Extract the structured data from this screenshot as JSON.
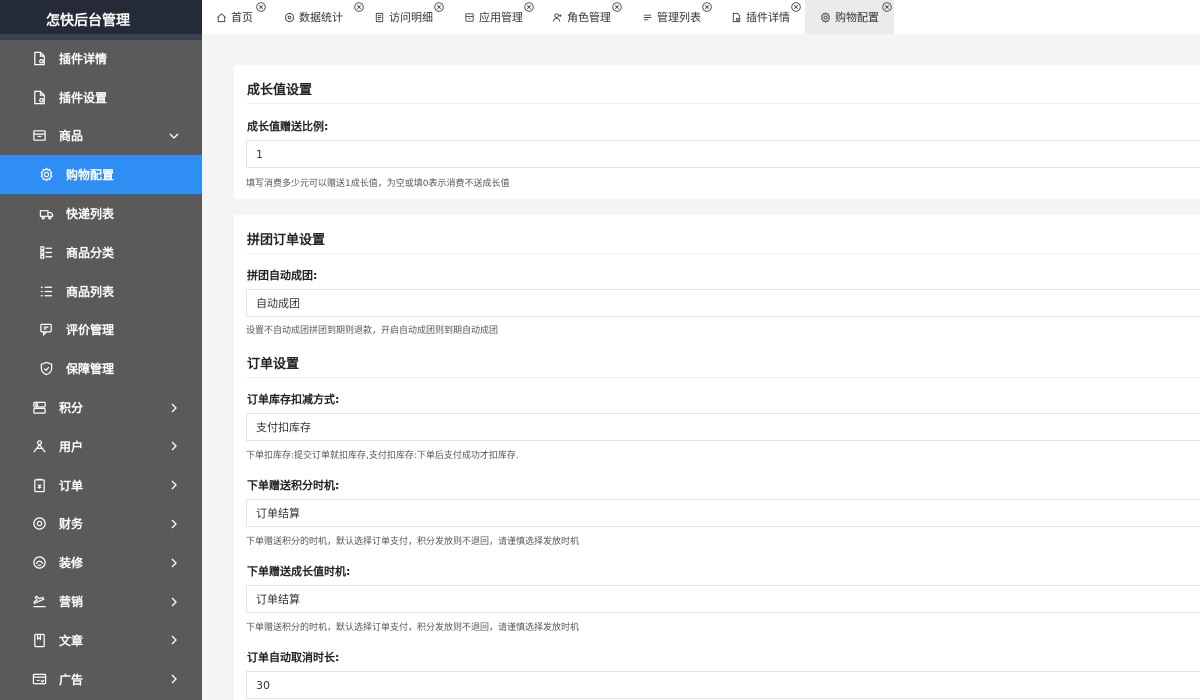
{
  "app": {
    "title": "怎快后台管理"
  },
  "tabs": [
    {
      "label": "首页",
      "icon": "home-icon"
    },
    {
      "label": "数据统计",
      "icon": "chart-icon"
    },
    {
      "label": "访问明细",
      "icon": "document-icon"
    },
    {
      "label": "应用管理",
      "icon": "app-icon"
    },
    {
      "label": "角色管理",
      "icon": "user-role-icon"
    },
    {
      "label": "管理列表",
      "icon": "list-icon"
    },
    {
      "label": "插件详情",
      "icon": "file-icon"
    },
    {
      "label": "购物配置",
      "icon": "gear-icon"
    }
  ],
  "sidebar": {
    "items": [
      {
        "label": "插件详情",
        "icon": "file-icon"
      },
      {
        "label": "插件设置",
        "icon": "file-settings-icon"
      },
      {
        "label": "商品",
        "icon": "box-icon"
      },
      {
        "label": "购物配置",
        "icon": "gear-icon"
      },
      {
        "label": "快递列表",
        "icon": "truck-icon"
      },
      {
        "label": "商品分类",
        "icon": "category-icon"
      },
      {
        "label": "商品列表",
        "icon": "list-icon"
      },
      {
        "label": "评价管理",
        "icon": "comment-icon"
      },
      {
        "label": "保障管理",
        "icon": "shield-icon"
      },
      {
        "label": "积分",
        "icon": "points-icon"
      },
      {
        "label": "用户",
        "icon": "user-icon"
      },
      {
        "label": "订单",
        "icon": "order-icon"
      },
      {
        "label": "财务",
        "icon": "finance-icon"
      },
      {
        "label": "装修",
        "icon": "decorate-icon"
      },
      {
        "label": "营销",
        "icon": "marketing-icon"
      },
      {
        "label": "文章",
        "icon": "article-icon"
      },
      {
        "label": "广告",
        "icon": "ad-icon"
      }
    ]
  },
  "growth": {
    "title": "成长值设置",
    "ratio_label": "成长值赠送比例:",
    "ratio_value": "1",
    "ratio_help": "填写消费多少元可以赠送1成长值，为空或填0表示消费不送成长值"
  },
  "group": {
    "title": "拼团订单设置",
    "auto_label": "拼团自动成团:",
    "auto_value": "自动成团",
    "auto_help": "设置不自动成团拼团到期则退款，开启自动成团则到期自动成团"
  },
  "order": {
    "title": "订单设置",
    "stock_label": "订单库存扣减方式:",
    "stock_value": "支付扣库存",
    "stock_help": "下单扣库存:提交订单就扣库存,支付扣库存:下单后支付成功才扣库存.",
    "points_label": "下单赠送积分时机:",
    "points_value": "订单结算",
    "points_help": "下单赠送积分的时机，默认选择订单支付，积分发放则不退回，请谨慎选择发放时机",
    "growth_label": "下单赠送成长值时机:",
    "growth_value": "订单结算",
    "growth_help": "下单赠送积分的时机，默认选择订单支付，积分发放则不退回，请谨慎选择发放时机",
    "cancel_label": "订单自动取消时长:",
    "cancel_value": "30"
  }
}
